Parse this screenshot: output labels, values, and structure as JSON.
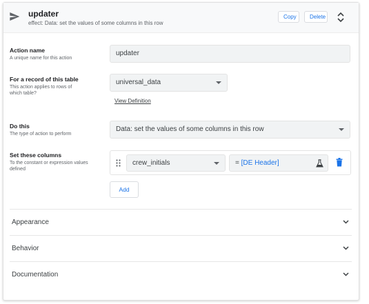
{
  "header": {
    "title": "updater",
    "effect": "effect: Data: set the values of some columns in this row",
    "copy_label": "Copy",
    "delete_label": "Delete"
  },
  "form": {
    "action_name": {
      "label": "Action name",
      "hint": "A unique name for this action",
      "value": "updater"
    },
    "table": {
      "label": "For a record of this table",
      "hint": "This action applies to rows of which table?",
      "value": "universal_data",
      "view_definition": "View Definition"
    },
    "do_this": {
      "label": "Do this",
      "hint": "The type of action to perform",
      "value": "Data: set the values of some columns in this row"
    },
    "set_columns": {
      "label": "Set these columns",
      "hint": "To the constant or expression values defined",
      "column": "crew_initials",
      "expr_prefix": "=",
      "expr_value": "[DE Header]",
      "add_label": "Add"
    }
  },
  "sections": [
    {
      "label": "Appearance"
    },
    {
      "label": "Behavior"
    },
    {
      "label": "Documentation"
    }
  ],
  "colors": {
    "accent": "#1a73e8",
    "field_bg": "#f1f3f4"
  }
}
